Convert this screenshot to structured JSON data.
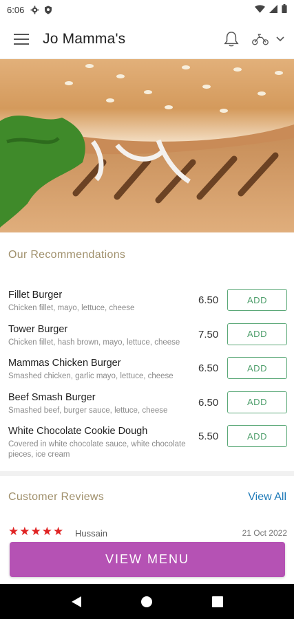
{
  "status_bar": {
    "time": "6:06",
    "icons": [
      "gear-icon",
      "shield-icon",
      "wifi-icon",
      "signal-icon",
      "battery-icon"
    ]
  },
  "header": {
    "title": "Jo Mamma's",
    "icons": [
      "menu-icon",
      "bell-icon",
      "scooter-icon",
      "chevron-down-icon"
    ]
  },
  "hero": {
    "image": "burger-hero-image"
  },
  "recommendations": {
    "title": "Our Recommendations",
    "add_label": "ADD",
    "items": [
      {
        "name": "Fillet Burger",
        "description": "Chicken fillet, mayo, lettuce, cheese",
        "price": "6.50",
        "add": "ADD"
      },
      {
        "name": "Tower Burger",
        "description": "Chicken fillet, hash brown, mayo, lettuce, cheese",
        "price": "7.50",
        "add": "ADD"
      },
      {
        "name": "Mammas Chicken Burger",
        "description": "Smashed chicken, garlic mayo, lettuce, cheese",
        "price": "6.50",
        "add": "ADD"
      },
      {
        "name": "Beef Smash Burger",
        "description": "Smashed beef, burger sauce, lettuce, cheese",
        "price": "6.50",
        "add": "ADD"
      },
      {
        "name": "White Chocolate Cookie Dough",
        "description": "Covered in white chocolate sauce, white chocolate pieces, ice cream",
        "price": "5.50",
        "add": "ADD"
      }
    ]
  },
  "reviews": {
    "title": "Customer Reviews",
    "view_all": "View All",
    "first": {
      "rating": 5,
      "reviewer": "Hussain",
      "date": "21 Oct 2022"
    }
  },
  "cta": {
    "label": "VIEW MENU"
  },
  "colors": {
    "accent_purple": "#b552b4",
    "add_green": "#4f9f6c",
    "section_title": "#a0906c",
    "link_blue": "#1f7ab8",
    "star_red": "#e02424"
  },
  "nav_bar": {
    "icons": [
      "back-icon",
      "home-icon",
      "recents-icon"
    ]
  }
}
